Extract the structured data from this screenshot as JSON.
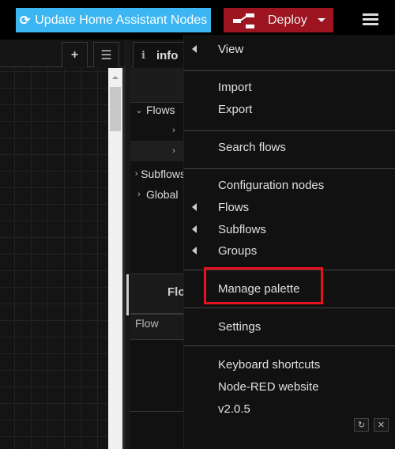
{
  "header": {
    "ha_button": {
      "icon": "refresh-icon",
      "glyph": "⟳",
      "label": "Update Home Assistant Nodes",
      "color": "#3bb6f2"
    },
    "deploy": {
      "icon": "deploy-icon",
      "label": "Deploy",
      "color": "#9c1520"
    },
    "menu_button": {
      "icon": "hamburger-icon"
    }
  },
  "workspace": {
    "add_tab_glyph": "+",
    "list_tabs_glyph": "☰"
  },
  "sidebar": {
    "tab": {
      "icon_glyph": "i",
      "label": "info"
    },
    "tree": [
      {
        "chevron": "⌄",
        "label": "Flows"
      },
      {
        "chevron": "›",
        "label": ""
      },
      {
        "chevron": "›",
        "label": ""
      },
      {
        "chevron": "›",
        "label": "Subflows"
      },
      {
        "chevron": "›",
        "label": "Global"
      }
    ],
    "lower_title": "Flow",
    "flow_label": "Flow"
  },
  "menu": {
    "items": [
      {
        "label": "View",
        "submenu": true
      },
      {
        "label": "Import",
        "submenu": false
      },
      {
        "label": "Export",
        "submenu": false
      },
      {
        "label": "Search flows",
        "submenu": false
      },
      {
        "label": "Configuration nodes",
        "submenu": false
      },
      {
        "label": "Flows",
        "submenu": true
      },
      {
        "label": "Subflows",
        "submenu": true
      },
      {
        "label": "Groups",
        "submenu": true
      },
      {
        "label": "Manage palette",
        "submenu": false,
        "highlighted": true
      },
      {
        "label": "Settings",
        "submenu": false
      },
      {
        "label": "Keyboard shortcuts",
        "submenu": false
      },
      {
        "label": "Node-RED website",
        "submenu": false
      },
      {
        "label": "v2.0.5",
        "submenu": false
      }
    ],
    "highlight_color": "#e8121f"
  },
  "footer_buttons": {
    "refresh_glyph": "↻",
    "close_glyph": "✕"
  }
}
